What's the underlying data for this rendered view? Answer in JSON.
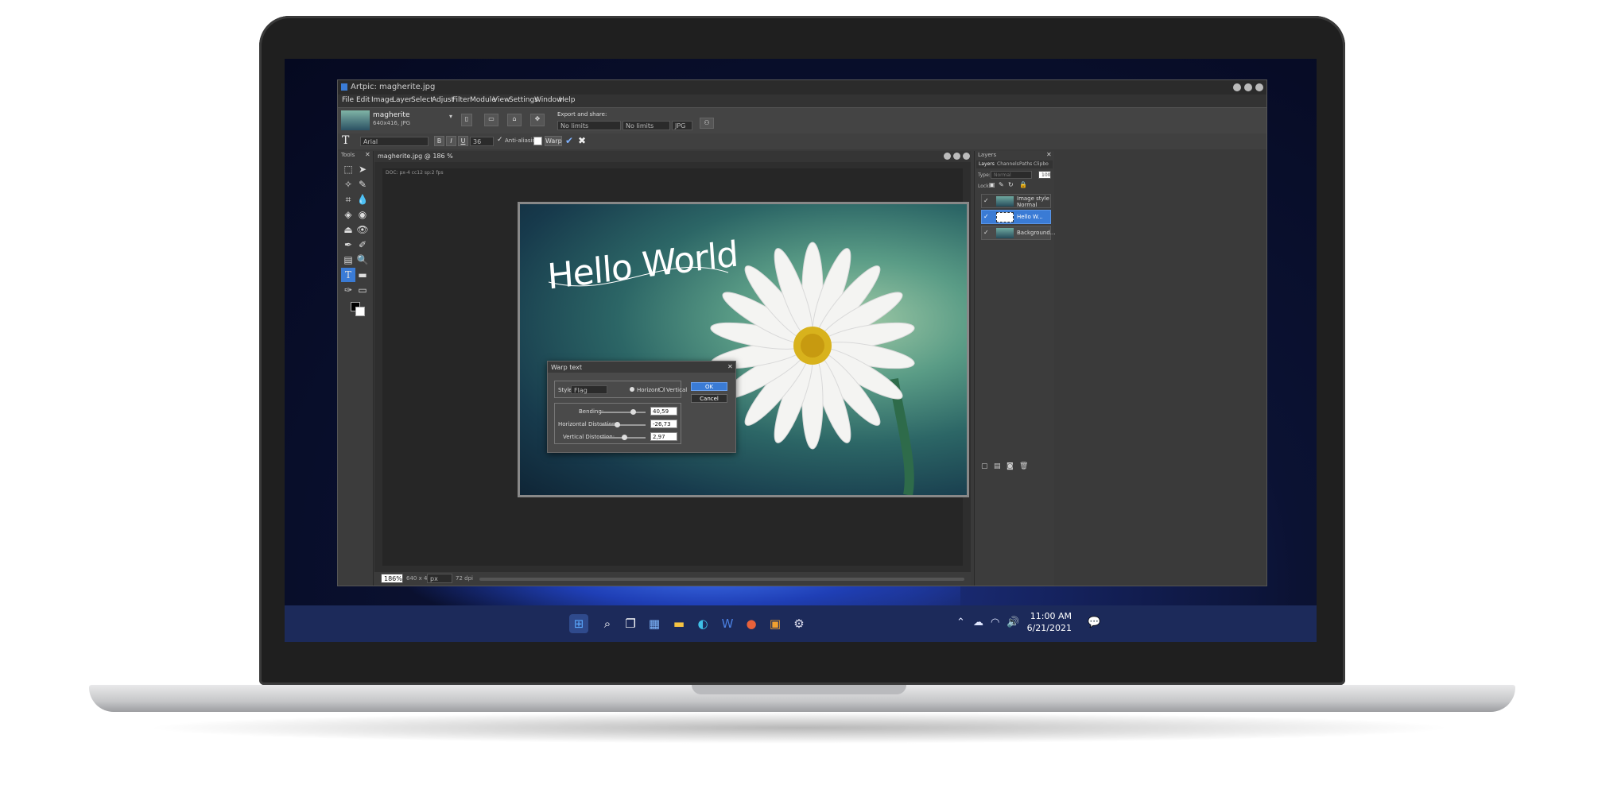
{
  "app": {
    "title": "Artpic: magherite.jpg",
    "menus": [
      "File",
      "Edit",
      "Image",
      "Layer",
      "Select",
      "Adjust",
      "Filter",
      "Module",
      "View",
      "Settings",
      "Window",
      "Help"
    ],
    "file_name": "magherite",
    "file_info": "640x416, JPG",
    "export_label": "Export and share:",
    "export_opts": [
      "No limits",
      "No limits",
      "JPG"
    ]
  },
  "text_toolbar": {
    "font": "Arial",
    "size": "36",
    "bold": "B",
    "italic": "I",
    "underline": "U",
    "antialias": "Anti-aliasing",
    "warp": "Warp"
  },
  "panels": {
    "tools_title": "Tools",
    "layers_title": "Layers",
    "tabs": [
      "Layers",
      "Channels",
      "Paths",
      "Clipbo"
    ],
    "type_label": "Type:",
    "type_value": "Normal",
    "opacity": "100",
    "lock_label": "Lock:"
  },
  "document": {
    "tab": "magherite.jpg @ 186 %",
    "doc_info": "DOC: px-4 cc12 sp:2 fps",
    "canvas_text": "Hello World",
    "zoom": "186%",
    "dims": "640 x 416",
    "unit": "px",
    "dpi": "72 dpi"
  },
  "layers": [
    {
      "name": "Image style",
      "sub": "Normal"
    },
    {
      "name": "Hello W..."
    },
    {
      "name": "Background..."
    }
  ],
  "warp_dialog": {
    "title": "Warp text",
    "style_label": "Style:",
    "style_value": "Flag",
    "orient": [
      "Horizontal",
      "Vertical"
    ],
    "ok": "OK",
    "cancel": "Cancel",
    "params": [
      {
        "label": "Bending:",
        "value": "40,59",
        "level": 0.72
      },
      {
        "label": "Horizontal Distortion:",
        "value": "-26,73",
        "level": 0.37
      },
      {
        "label": "Vertical Distortion:",
        "value": "2,97",
        "level": 0.52
      }
    ]
  },
  "taskbar": {
    "time": "11:00 AM",
    "date": "6/21/2021"
  },
  "colors": {
    "accent": "#3a7bd5",
    "taskbar": "#1c2a5a",
    "panel": "#3c3c3c"
  }
}
